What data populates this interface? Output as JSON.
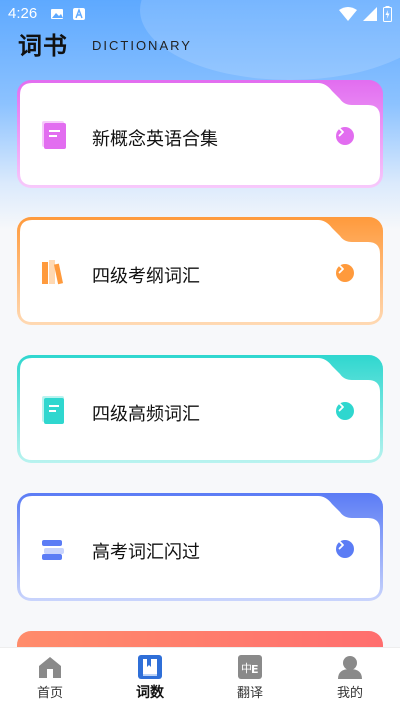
{
  "status": {
    "time": "4:26"
  },
  "header": {
    "title": "词书",
    "subtitle": "DICTIONARY"
  },
  "cards": [
    {
      "title": "新概念英语合集",
      "color": "#e26df0",
      "light": "#f7c9fb",
      "icon": "pink-book-icon"
    },
    {
      "title": "四级考纲词汇",
      "color": "#ff9a3c",
      "light": "#ffd9b3",
      "icon": "books-stack-icon"
    },
    {
      "title": "四级高频词汇",
      "color": "#2fd7cf",
      "light": "#b9f3ef",
      "icon": "teal-book-icon"
    },
    {
      "title": "高考词汇闪过",
      "color": "#5b7cf5",
      "light": "#c9d4fc",
      "icon": "layered-stack-icon"
    }
  ],
  "tabs": [
    {
      "label": "首页",
      "icon": "home-icon"
    },
    {
      "label": "词数",
      "icon": "dictionary-book-icon"
    },
    {
      "label": "翻译",
      "icon": "translate-icon"
    },
    {
      "label": "我的",
      "icon": "user-icon"
    }
  ]
}
